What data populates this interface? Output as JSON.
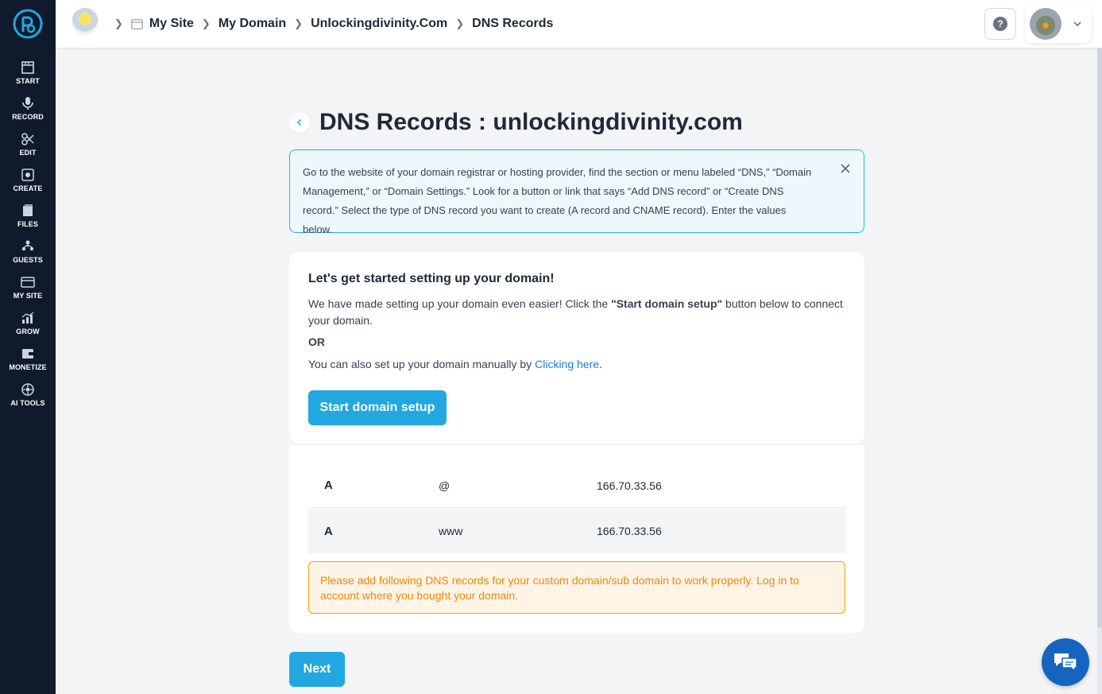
{
  "sidebar": {
    "items": [
      {
        "label": "START",
        "icon": "start-icon"
      },
      {
        "label": "RECORD",
        "icon": "microphone-icon"
      },
      {
        "label": "EDIT",
        "icon": "edit-icon"
      },
      {
        "label": "CREATE",
        "icon": "create-icon"
      },
      {
        "label": "FILES",
        "icon": "files-icon"
      },
      {
        "label": "GUESTS",
        "icon": "guests-icon"
      },
      {
        "label": "MY SITE",
        "icon": "site-icon"
      },
      {
        "label": "GROW",
        "icon": "grow-icon"
      },
      {
        "label": "MONETIZE",
        "icon": "monetize-icon"
      },
      {
        "label": "AI TOOLS",
        "icon": "ai-tools-icon"
      }
    ]
  },
  "header": {
    "breadcrumbs": [
      "My Site",
      "My Domain",
      "Unlockingdivinity.Com",
      "DNS Records"
    ],
    "help_label": "?"
  },
  "page": {
    "title": "DNS Records : unlockingdivinity.com"
  },
  "info": {
    "text": "Go to the website of your domain registrar or hosting provider, find the section or menu labeled “DNS,” “Domain Management,” or “Domain Settings.” Look for a button or link that says “Add DNS record” or “Create DNS record.” Select the type of DNS record you want to create (A record and CNAME record). Enter the values below."
  },
  "setup": {
    "title": "Let's get started setting up your domain!",
    "text_before": "We have made setting up your domain even easier! Click the ",
    "text_bold": "\"Start domain setup\"",
    "text_after": " button below to connect your domain.",
    "or_label": "OR",
    "manual_text": "You can also set up your domain manually by ",
    "manual_link": "Clicking here",
    "manual_end": ".",
    "button_label": "Start domain setup"
  },
  "records": {
    "rows": [
      {
        "type": "A",
        "host": "@",
        "value": "166.70.33.56"
      },
      {
        "type": "A",
        "host": "www",
        "value": "166.70.33.56"
      }
    ],
    "warning": "Please add following DNS records for your custom domain/sub domain to work properly. Log in to account where you bought your domain."
  },
  "footer": {
    "next_label": "Next"
  },
  "colors": {
    "sidebar_bg": "#0f1b2d",
    "accent": "#22a7e0",
    "info_border": "#22b8cf",
    "warning": "#e8890c",
    "chat": "#1565c0"
  }
}
